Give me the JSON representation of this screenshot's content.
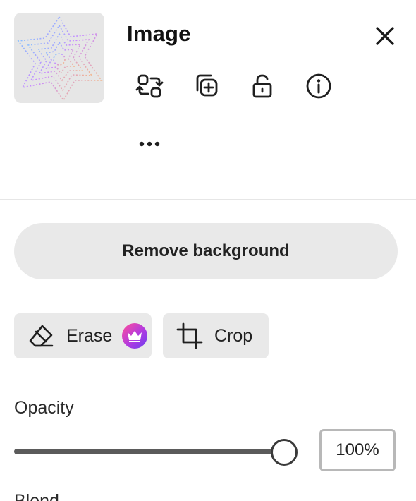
{
  "panel": {
    "title": "Image",
    "thumbnail_alt": "layer-thumbnail",
    "actions": [
      {
        "icon": "replace-icon"
      },
      {
        "icon": "duplicate-icon"
      },
      {
        "icon": "unlock-icon"
      },
      {
        "icon": "info-icon"
      },
      {
        "icon": "more-icon"
      }
    ],
    "close_icon": "close-icon"
  },
  "tools": {
    "remove_background_label": "Remove background",
    "erase_label": "Erase",
    "erase_premium_icon": "crown-icon",
    "crop_label": "Crop"
  },
  "opacity": {
    "label": "Opacity",
    "value_text": "100%",
    "value": 1.0
  },
  "blend": {
    "label": "Blend"
  },
  "colors": {
    "premium_gradient_start": "#ff4f9a",
    "premium_gradient_end": "#6a3df0",
    "button_bg": "#e9e9e9"
  }
}
